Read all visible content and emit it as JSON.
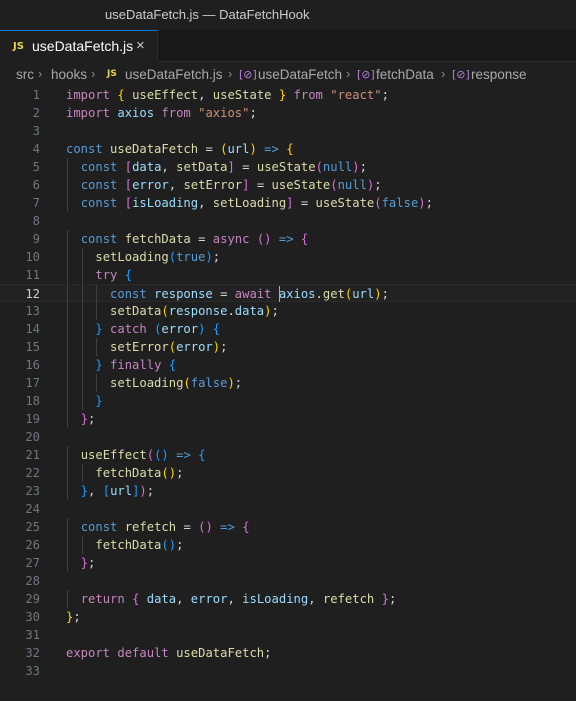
{
  "window": {
    "title": "useDataFetch.js — DataFetchHook"
  },
  "tab": {
    "icon": "JS",
    "label": "useDataFetch.js",
    "close": "×"
  },
  "breadcrumb": {
    "items": [
      "src",
      "hooks",
      "useDataFetch.js",
      "useDataFetch",
      "fetchData",
      "response"
    ]
  },
  "editor": {
    "current_line": 12,
    "lines": [
      "import { useEffect, useState } from \"react\";",
      "import axios from \"axios\";",
      "",
      "const useDataFetch = (url) => {",
      "  const [data, setData] = useState(null);",
      "  const [error, setError] = useState(null);",
      "  const [isLoading, setLoading] = useState(false);",
      "",
      "  const fetchData = async () => {",
      "    setLoading(true);",
      "    try {",
      "      const response = await axios.get(url);",
      "      setData(response.data);",
      "    } catch (error) {",
      "      setError(error);",
      "    } finally {",
      "      setLoading(false);",
      "    }",
      "  };",
      "",
      "  useEffect(() => {",
      "    fetchData();",
      "  }, [url]);",
      "",
      "  const refetch = () => {",
      "    fetchData();",
      "  };",
      "",
      "  return { data, error, isLoading, refetch };",
      "};",
      "",
      "export default useDataFetch;",
      ""
    ]
  },
  "colors": {
    "background": "#1f1f1f",
    "keyword_control": "#c586c0",
    "keyword_storage": "#569cd6",
    "function": "#dcdcaa",
    "variable": "#9cdcfe",
    "string": "#ce9178"
  }
}
